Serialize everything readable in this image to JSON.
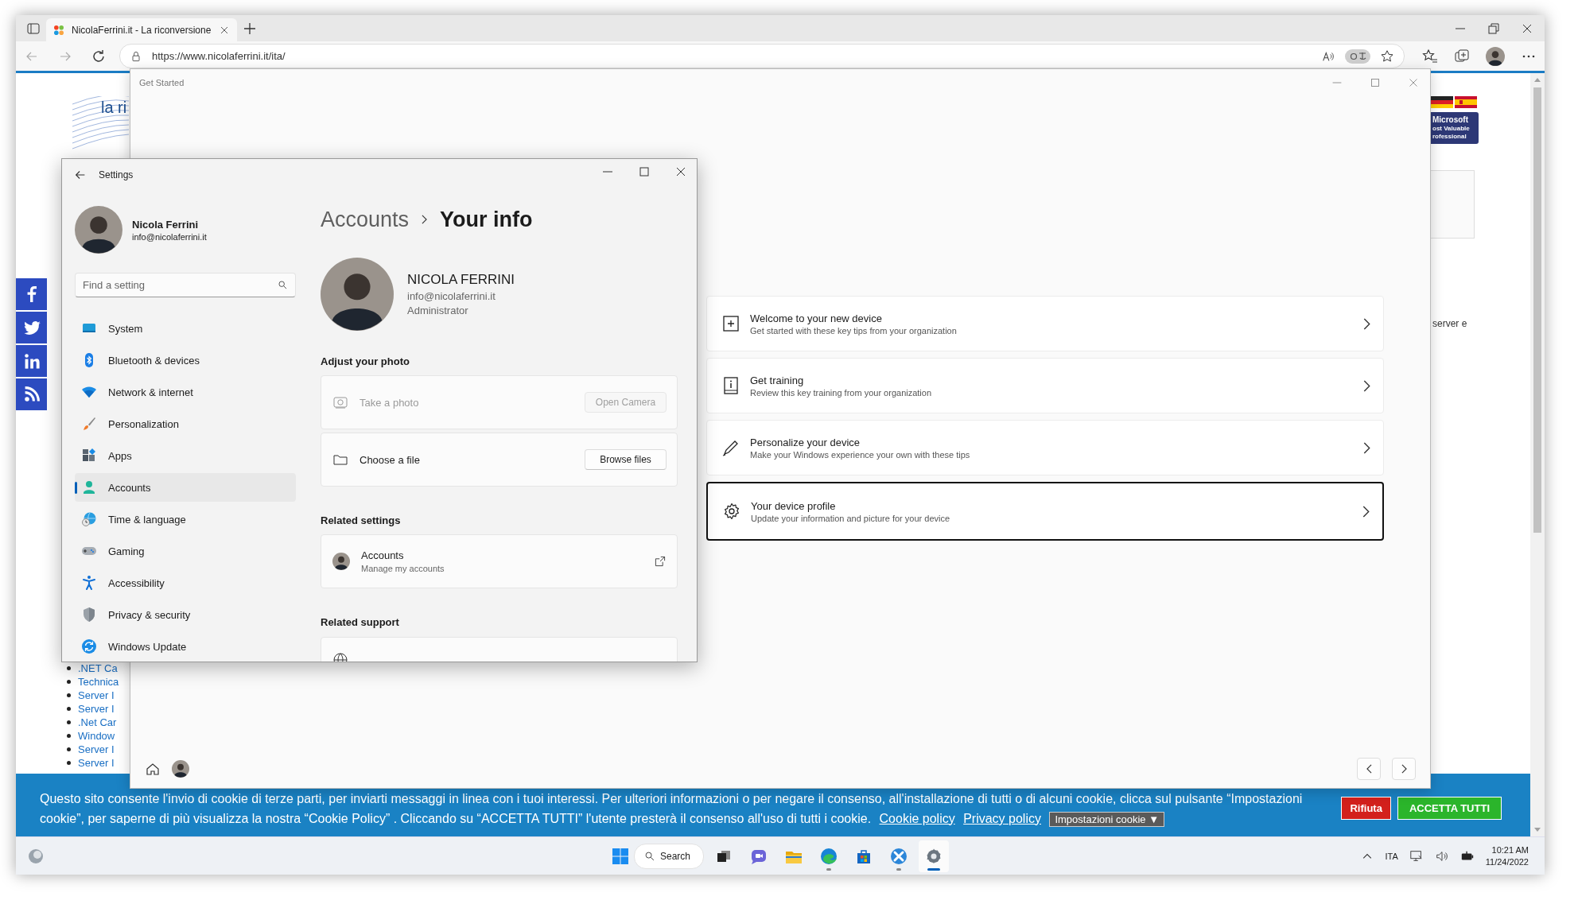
{
  "browser": {
    "tab_title": "NicolaFerrini.it - La riconversione",
    "address": "https://www.nicolaferrini.it/ita/"
  },
  "webpage": {
    "logo_text": "la ri",
    "badge_lines": [
      "Microsoft",
      "ost Valuable",
      "rofessional"
    ],
    "side_text": "server e",
    "links": [
      ".NET Ca",
      "Technica",
      "Server I",
      "Server I",
      ".Net Car",
      "Window",
      "Server I",
      "Server I"
    ]
  },
  "get_started": {
    "title": "Get Started",
    "cards": [
      {
        "title": "Welcome to your new device",
        "subtitle": "Get started with these key tips from your organization",
        "selected": false
      },
      {
        "title": "Get training",
        "subtitle": "Review this key training from your organization",
        "selected": false
      },
      {
        "title": "Personalize your device",
        "subtitle": "Make your Windows experience your own with these tips",
        "selected": false
      },
      {
        "title": "Your device profile",
        "subtitle": "Update your information and picture for your device",
        "selected": true
      }
    ]
  },
  "settings": {
    "title": "Settings",
    "user": {
      "name": "Nicola Ferrini",
      "email": "info@nicolaferrini.it"
    },
    "search": {
      "placeholder": "Find a setting"
    },
    "nav": [
      {
        "label": "System",
        "selected": false
      },
      {
        "label": "Bluetooth & devices",
        "selected": false
      },
      {
        "label": "Network & internet",
        "selected": false
      },
      {
        "label": "Personalization",
        "selected": false
      },
      {
        "label": "Apps",
        "selected": false
      },
      {
        "label": "Accounts",
        "selected": true
      },
      {
        "label": "Time & language",
        "selected": false
      },
      {
        "label": "Gaming",
        "selected": false
      },
      {
        "label": "Accessibility",
        "selected": false
      },
      {
        "label": "Privacy & security",
        "selected": false
      },
      {
        "label": "Windows Update",
        "selected": false
      }
    ],
    "breadcrumb": [
      "Accounts",
      "Your info"
    ],
    "profile": {
      "name": "NICOLA FERRINI",
      "email": "info@nicolaferrini.it",
      "role": "Administrator"
    },
    "adjust_photo": {
      "heading": "Adjust your photo",
      "rows": [
        {
          "label": "Take a photo",
          "button": "Open Camera",
          "disabled": true
        },
        {
          "label": "Choose a file",
          "button": "Browse files",
          "disabled": false
        }
      ]
    },
    "related_settings": {
      "heading": "Related settings",
      "items": [
        {
          "title": "Accounts",
          "subtitle": "Manage my accounts"
        }
      ]
    },
    "related_support": {
      "heading": "Related support"
    }
  },
  "cookie_banner": {
    "text": "Questo sito consente l'invio di cookie di terze parti, per inviarti messaggi in linea con i tuoi interessi. Per ulteriori informazioni o per negare il consenso, all'installazione di tutti o di alcuni cookie, clicca sul pulsante “Impostazioni cookie”, per saperne di più visualizza la nostra “Cookie Policy” . Cliccando su “ACCETTA TUTTI” l'utente presterà il consenso all'uso di tutti i cookie.",
    "links": [
      "Cookie policy",
      "Privacy policy"
    ],
    "settings_button": "Impostazioni cookie ▼",
    "buttons": [
      {
        "label": "Rifiuta",
        "kind": "reject"
      },
      {
        "label": "ACCETTA TUTTI",
        "kind": "accept"
      }
    ]
  },
  "taskbar": {
    "search_label": "Search",
    "apps": [
      {
        "running": false,
        "selected": false
      },
      {
        "running": false,
        "selected": false
      },
      {
        "running": false,
        "selected": false
      },
      {
        "running": true,
        "selected": false
      },
      {
        "running": false,
        "selected": false
      },
      {
        "running": true,
        "selected": false
      },
      {
        "running": true,
        "selected": true
      }
    ],
    "language": "ITA",
    "time": "10:21 AM",
    "date": "11/24/2022"
  }
}
